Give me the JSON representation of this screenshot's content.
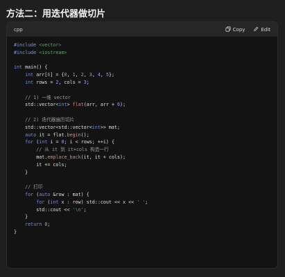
{
  "heading": "方法二：用迭代器做切片",
  "code_block": {
    "language": "cpp",
    "copy_label": "Copy",
    "edit_label": "Edit",
    "lines": [
      [
        {
          "t": "#include",
          "c": "pp"
        },
        {
          "t": " <vector>",
          "c": "inc"
        }
      ],
      [
        {
          "t": "#include",
          "c": "pp"
        },
        {
          "t": " <iostream>",
          "c": "inc"
        }
      ],
      [],
      [
        {
          "t": "int",
          "c": "kw"
        },
        {
          "t": " main() {",
          "c": ""
        }
      ],
      [
        {
          "t": "    ",
          "c": ""
        },
        {
          "t": "int",
          "c": "kw"
        },
        {
          "t": " arr[",
          "c": ""
        },
        {
          "t": "6",
          "c": "num"
        },
        {
          "t": "] = {",
          "c": ""
        },
        {
          "t": "0",
          "c": "num"
        },
        {
          "t": ", ",
          "c": ""
        },
        {
          "t": "1",
          "c": "num"
        },
        {
          "t": ", ",
          "c": ""
        },
        {
          "t": "2",
          "c": "num"
        },
        {
          "t": ", ",
          "c": ""
        },
        {
          "t": "3",
          "c": "num"
        },
        {
          "t": ", ",
          "c": ""
        },
        {
          "t": "4",
          "c": "num"
        },
        {
          "t": ", ",
          "c": ""
        },
        {
          "t": "5",
          "c": "num"
        },
        {
          "t": "};",
          "c": ""
        }
      ],
      [
        {
          "t": "    ",
          "c": ""
        },
        {
          "t": "int",
          "c": "kw"
        },
        {
          "t": " rows = ",
          "c": ""
        },
        {
          "t": "2",
          "c": "num"
        },
        {
          "t": ", cols = ",
          "c": ""
        },
        {
          "t": "3",
          "c": "num"
        },
        {
          "t": ";",
          "c": ""
        }
      ],
      [],
      [
        {
          "t": "    // 1) 一维 vector",
          "c": "cm"
        }
      ],
      [
        {
          "t": "    std::vector<",
          "c": ""
        },
        {
          "t": "int",
          "c": "kw"
        },
        {
          "t": "> ",
          "c": ""
        },
        {
          "t": "flat",
          "c": "fn"
        },
        {
          "t": "(arr, arr + ",
          "c": ""
        },
        {
          "t": "6",
          "c": "num"
        },
        {
          "t": ");",
          "c": ""
        }
      ],
      [],
      [
        {
          "t": "    // 2) 迭代器遍历切片",
          "c": "cm"
        }
      ],
      [
        {
          "t": "    std::vector<std::vector<",
          "c": ""
        },
        {
          "t": "int",
          "c": "kw"
        },
        {
          "t": ">> mat;",
          "c": ""
        }
      ],
      [
        {
          "t": "    ",
          "c": ""
        },
        {
          "t": "auto",
          "c": "kw"
        },
        {
          "t": " it = flat.",
          "c": ""
        },
        {
          "t": "begin",
          "c": "fn"
        },
        {
          "t": "();",
          "c": ""
        }
      ],
      [
        {
          "t": "    ",
          "c": ""
        },
        {
          "t": "for",
          "c": "kw"
        },
        {
          "t": " (",
          "c": ""
        },
        {
          "t": "int",
          "c": "kw"
        },
        {
          "t": " i = ",
          "c": ""
        },
        {
          "t": "0",
          "c": "num"
        },
        {
          "t": "; i < rows; ++i) {",
          "c": ""
        }
      ],
      [
        {
          "t": "        // 从 it 到 it+cols 构造一行",
          "c": "cm"
        }
      ],
      [
        {
          "t": "        mat.",
          "c": ""
        },
        {
          "t": "emplace_back",
          "c": "fn"
        },
        {
          "t": "(it, it + cols);",
          "c": ""
        }
      ],
      [
        {
          "t": "        it += cols;",
          "c": ""
        }
      ],
      [
        {
          "t": "    }",
          "c": ""
        }
      ],
      [],
      [
        {
          "t": "    // 打印",
          "c": "cm"
        }
      ],
      [
        {
          "t": "    ",
          "c": ""
        },
        {
          "t": "for",
          "c": "kw"
        },
        {
          "t": " (",
          "c": ""
        },
        {
          "t": "auto",
          "c": "kw"
        },
        {
          "t": " &row : mat) {",
          "c": ""
        }
      ],
      [
        {
          "t": "        ",
          "c": ""
        },
        {
          "t": "for",
          "c": "kw"
        },
        {
          "t": " (",
          "c": ""
        },
        {
          "t": "int",
          "c": "kw"
        },
        {
          "t": " x : row) std::cout << x << ",
          "c": ""
        },
        {
          "t": "' '",
          "c": "str"
        },
        {
          "t": ";",
          "c": ""
        }
      ],
      [
        {
          "t": "        std::cout << ",
          "c": ""
        },
        {
          "t": "'\\n'",
          "c": "str"
        },
        {
          "t": ";",
          "c": ""
        }
      ],
      [
        {
          "t": "    }",
          "c": ""
        }
      ],
      [
        {
          "t": "    ",
          "c": ""
        },
        {
          "t": "return",
          "c": "kw"
        },
        {
          "t": " ",
          "c": ""
        },
        {
          "t": "0",
          "c": "num"
        },
        {
          "t": ";",
          "c": ""
        }
      ],
      [
        {
          "t": "}",
          "c": ""
        }
      ]
    ]
  }
}
